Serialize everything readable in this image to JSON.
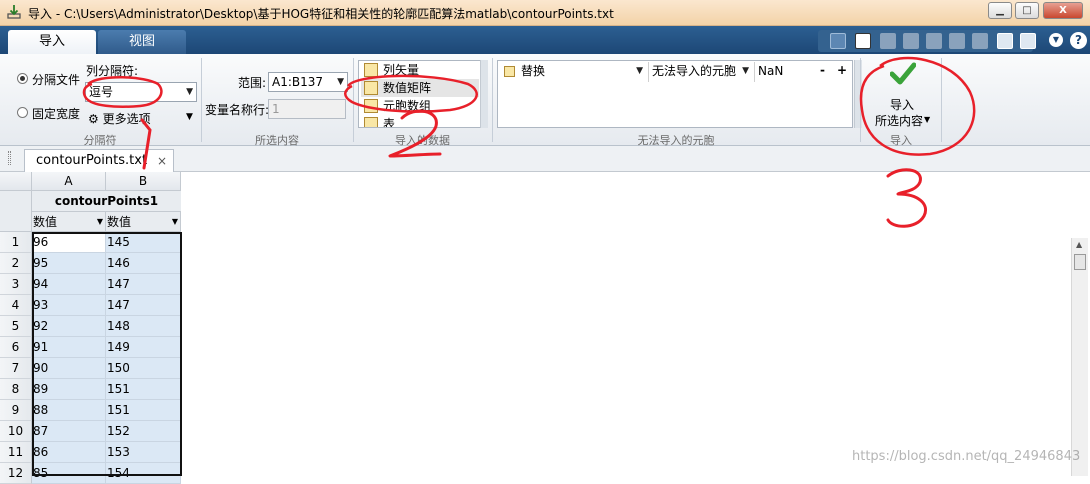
{
  "window": {
    "title": "导入 - C:\\Users\\Administrator\\Desktop\\基于HOG特征和相关性的轮廓匹配算法matlab\\contourPoints.txt",
    "minimize": "▁",
    "maximize": "□",
    "close": "X"
  },
  "tabs": {
    "import": "导入",
    "view": "视图"
  },
  "ribbon": {
    "delimiter_group": {
      "delimited_label": "分隔文件",
      "fixed_width_label": "固定宽度",
      "column_delimiter_label": "列分隔符:",
      "column_delimiter_value": "逗号",
      "more_options": "更多选项",
      "group_label": "分隔符"
    },
    "selection_group": {
      "range_label": "范围:",
      "range_value": "A1:B137",
      "varname_row_label": "变量名称行:",
      "varname_row_value": "1",
      "group_label": "所选内容"
    },
    "output_group": {
      "items": [
        "列矢量",
        "数值矩阵",
        "元胞数组",
        "表"
      ],
      "group_label": "导入的数据"
    },
    "unimportable_group": {
      "action": "替换",
      "condition": "无法导入的元胞",
      "value": "NaN",
      "minus": "-",
      "plus": "+",
      "group_label": "无法导入的元胞"
    },
    "import_group": {
      "button_line1": "导入",
      "button_line2": "所选内容",
      "group_label": "导入"
    }
  },
  "file_tab": {
    "name": "contourPoints.txt",
    "close": "×"
  },
  "annotations": [
    "1",
    "2",
    "3"
  ],
  "watermark": "https://blog.csdn.net/qq_24946843",
  "chart_data": {
    "type": "table",
    "column_letters": [
      "A",
      "B"
    ],
    "variable_name": "contourPoints1",
    "column_types": [
      "数值",
      "数值"
    ],
    "row_numbers": [
      "1",
      "2",
      "3",
      "4",
      "5",
      "6",
      "7",
      "8",
      "9",
      "10",
      "11",
      "12"
    ],
    "rows": [
      [
        "96",
        "145"
      ],
      [
        "95",
        "146"
      ],
      [
        "94",
        "147"
      ],
      [
        "93",
        "147"
      ],
      [
        "92",
        "148"
      ],
      [
        "91",
        "149"
      ],
      [
        "90",
        "150"
      ],
      [
        "89",
        "151"
      ],
      [
        "88",
        "151"
      ],
      [
        "87",
        "152"
      ],
      [
        "86",
        "153"
      ],
      [
        "85",
        "154"
      ]
    ]
  },
  "colors": {
    "ribbon_header": "#1d4776",
    "selected_cell_bg": "#dbe8f5",
    "annotation_red": "#e8202a"
  }
}
